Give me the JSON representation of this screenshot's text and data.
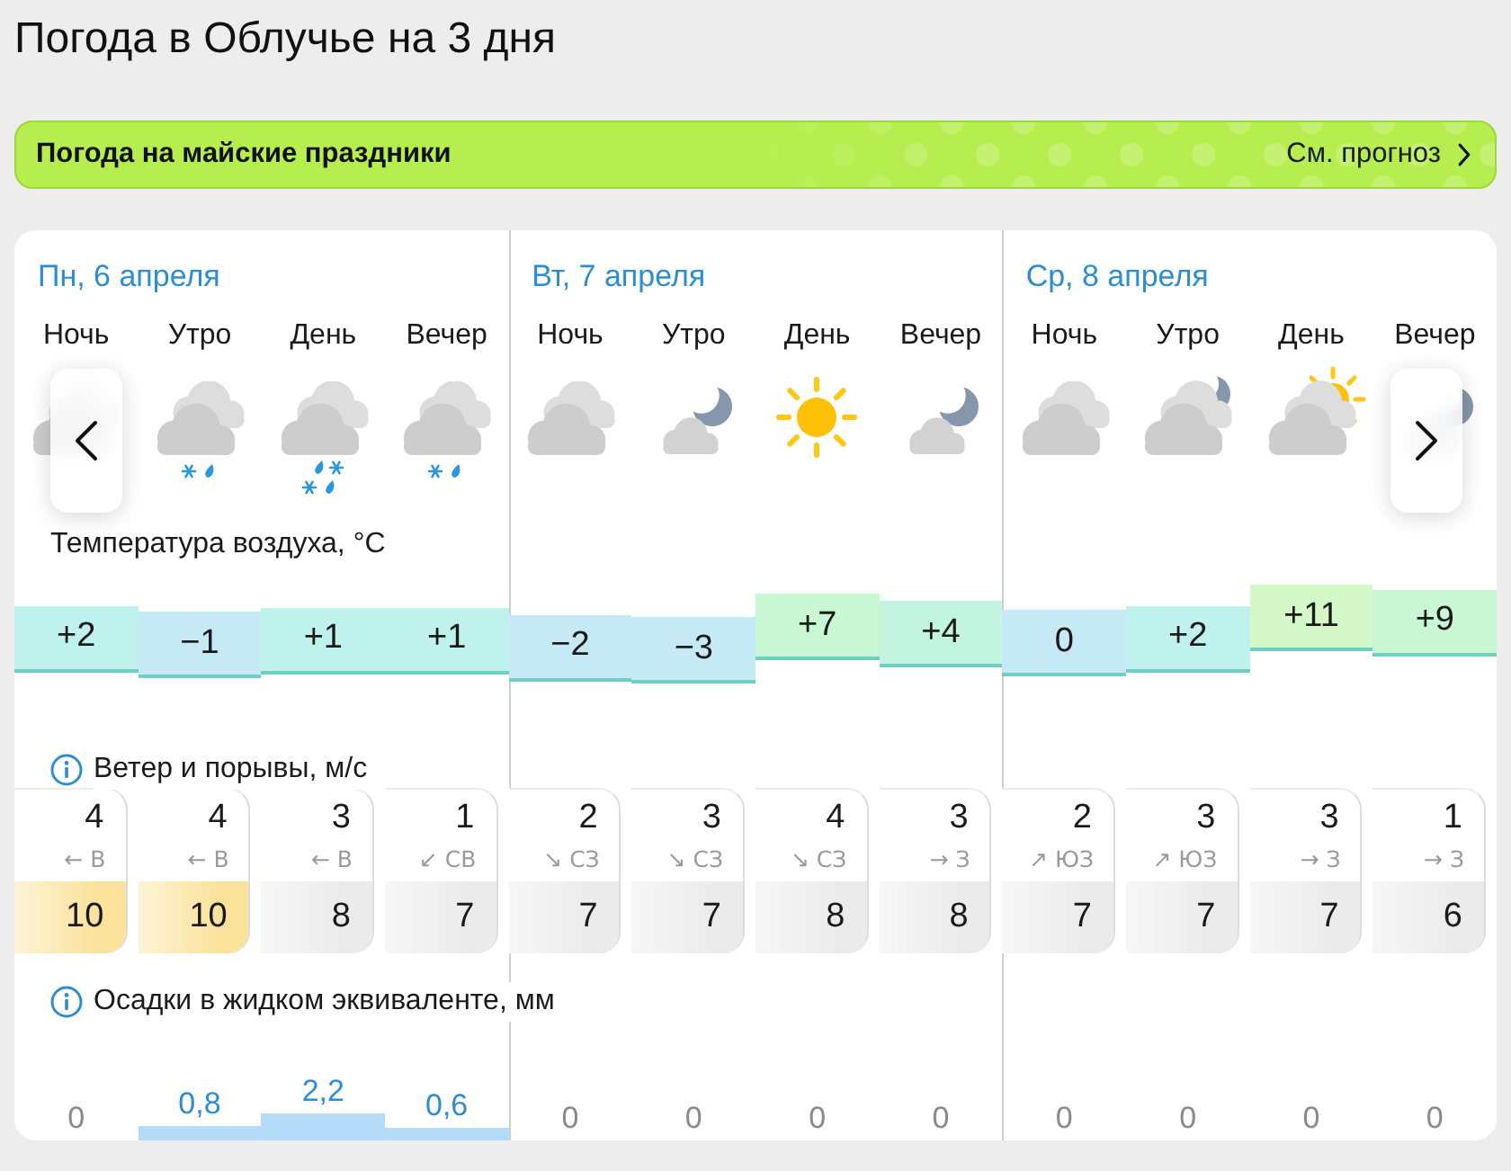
{
  "title": "Погода в Облучье на 3 дня",
  "banner": {
    "title": "Погода на майские праздники",
    "link": "См. прогноз"
  },
  "days": [
    {
      "date": "Пн, 6 апреля",
      "periods": [
        {
          "name": "Ночь",
          "kind": "overcast"
        },
        {
          "name": "Утро",
          "kind": "sleet"
        },
        {
          "name": "День",
          "kind": "heavysleet"
        },
        {
          "name": "Вечер",
          "kind": "sleet"
        }
      ]
    },
    {
      "date": "Вт, 7 апреля",
      "periods": [
        {
          "name": "Ночь",
          "kind": "overcast"
        },
        {
          "name": "Утро",
          "kind": "moon"
        },
        {
          "name": "День",
          "kind": "sun"
        },
        {
          "name": "Вечер",
          "kind": "moon"
        }
      ]
    },
    {
      "date": "Ср, 8 апреля",
      "periods": [
        {
          "name": "Ночь",
          "kind": "overcast"
        },
        {
          "name": "Утро",
          "kind": "overcastmoon"
        },
        {
          "name": "День",
          "kind": "overcastsun"
        },
        {
          "name": "Вечер",
          "kind": "moon"
        }
      ]
    }
  ],
  "temperature": {
    "label": "Температура воздуха, °C",
    "values": [
      {
        "text": "+2",
        "color": "#bff2ec"
      },
      {
        "text": "−1",
        "color": "#c5eaf6"
      },
      {
        "text": "+1",
        "color": "#bff2ec"
      },
      {
        "text": "+1",
        "color": "#bff2ec"
      },
      {
        "text": "−2",
        "color": "#c5eaf6"
      },
      {
        "text": "−3",
        "color": "#c5eaf6"
      },
      {
        "text": "+7",
        "color": "#c9f7d3"
      },
      {
        "text": "+4",
        "color": "#c3f4df"
      },
      {
        "text": "0",
        "color": "#c5eaf6"
      },
      {
        "text": "+2",
        "color": "#bff2ec"
      },
      {
        "text": "+11",
        "color": "#d4f8c8"
      },
      {
        "text": "+9",
        "color": "#c9f7d3"
      }
    ]
  },
  "wind": {
    "label": "Ветер и порывы, м/с",
    "values": [
      {
        "speed": "4",
        "direction": "← В",
        "gust": "10",
        "color": "#fbe29a"
      },
      {
        "speed": "4",
        "direction": "← В",
        "gust": "10",
        "color": "#fbe29a"
      },
      {
        "speed": "3",
        "direction": "← В",
        "gust": "8",
        "color": "#ebebeb"
      },
      {
        "speed": "1",
        "direction": "↙ СВ",
        "gust": "7",
        "color": "#ebebeb"
      },
      {
        "speed": "2",
        "direction": "↘ СЗ",
        "gust": "7",
        "color": "#ebebeb"
      },
      {
        "speed": "3",
        "direction": "↘ СЗ",
        "gust": "7",
        "color": "#ebebeb"
      },
      {
        "speed": "4",
        "direction": "↘ СЗ",
        "gust": "8",
        "color": "#ebebeb"
      },
      {
        "speed": "3",
        "direction": "→ З",
        "gust": "8",
        "color": "#ebebeb"
      },
      {
        "speed": "2",
        "direction": "↗ ЮЗ",
        "gust": "7",
        "color": "#ebebeb"
      },
      {
        "speed": "3",
        "direction": "↗ ЮЗ",
        "gust": "7",
        "color": "#ebebeb"
      },
      {
        "speed": "3",
        "direction": "→ З",
        "gust": "7",
        "color": "#ebebeb"
      },
      {
        "speed": "1",
        "direction": "→ З",
        "gust": "6",
        "color": "#ebebeb"
      }
    ]
  },
  "precipitation": {
    "label": "Осадки в жидком эквиваленте, мм",
    "values": [
      {
        "text": "0"
      },
      {
        "text": "0,8"
      },
      {
        "text": "2,2"
      },
      {
        "text": "0,6"
      },
      {
        "text": "0"
      },
      {
        "text": "0"
      },
      {
        "text": "0"
      },
      {
        "text": "0"
      },
      {
        "text": "0"
      },
      {
        "text": "0"
      },
      {
        "text": "0"
      },
      {
        "text": "0"
      }
    ]
  }
}
